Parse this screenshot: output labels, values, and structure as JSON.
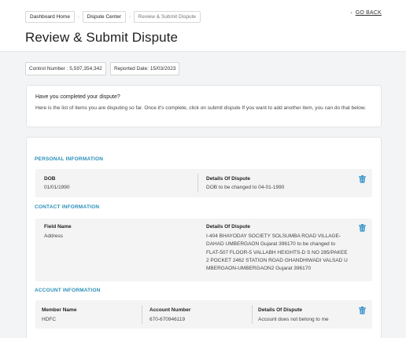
{
  "breadcrumb": {
    "items": [
      "Dashboard Home",
      "Dispute Center",
      "Review & Submit Dispute"
    ],
    "separator": "›"
  },
  "go_back": {
    "arrow": "‹",
    "label": "GO BACK"
  },
  "page_title": "Review & Submit Dispute",
  "reference": {
    "control_number": "Control Number : 5,597,354,342",
    "reported_date": "Reported Date: 15/03/2023"
  },
  "notice": {
    "question": "Have you completed your dispute?",
    "description": "Here is the list of items you are disputing so far. Once it's complete, click on submit dispute If you want to add another item, you can do that below."
  },
  "sections": {
    "personal": {
      "title": "PERSONAL INFORMATION",
      "col1_label": "DOB",
      "col1_value": "01/01/1990",
      "col2_label": "Details Of Dispute",
      "col2_value": "DOB to be changed to 04-01-1990"
    },
    "contact": {
      "title": "CONTACT INFORMATION",
      "col1_label": "Field Name",
      "col1_value": "Address",
      "col2_label": "Details Of Dispute",
      "col2_value": "I-404 BHAYODAY SOCIETY SOLSUMBA ROAD VILLAGE- DAHAD UMBERGAON Gujarat 396170 to be changed to FLAT-507 FLOOR-5 VALLABH HEIGHTS-D S NO 285/PAKEE 2 POCKET 2462 STATION ROAD GHANDHIWADI VALSAD U MBERGAON-UMBERGAON2 Gujarat 396170"
    },
    "account": {
      "title": "ACCOUNT INFORMATION",
      "col1_label": "Member Name",
      "col1_value": "HDFC",
      "col2_label": "Account Number",
      "col2_value": "670-670946119",
      "col3_label": "Details Of Dispute",
      "col3_value": "Account does not belong to me"
    }
  },
  "colors": {
    "accent": "#2a8fb8",
    "delete_icon": "#2f8fc9",
    "page_background": "#f3f4f5"
  },
  "icons": {
    "delete": "trash-icon"
  }
}
